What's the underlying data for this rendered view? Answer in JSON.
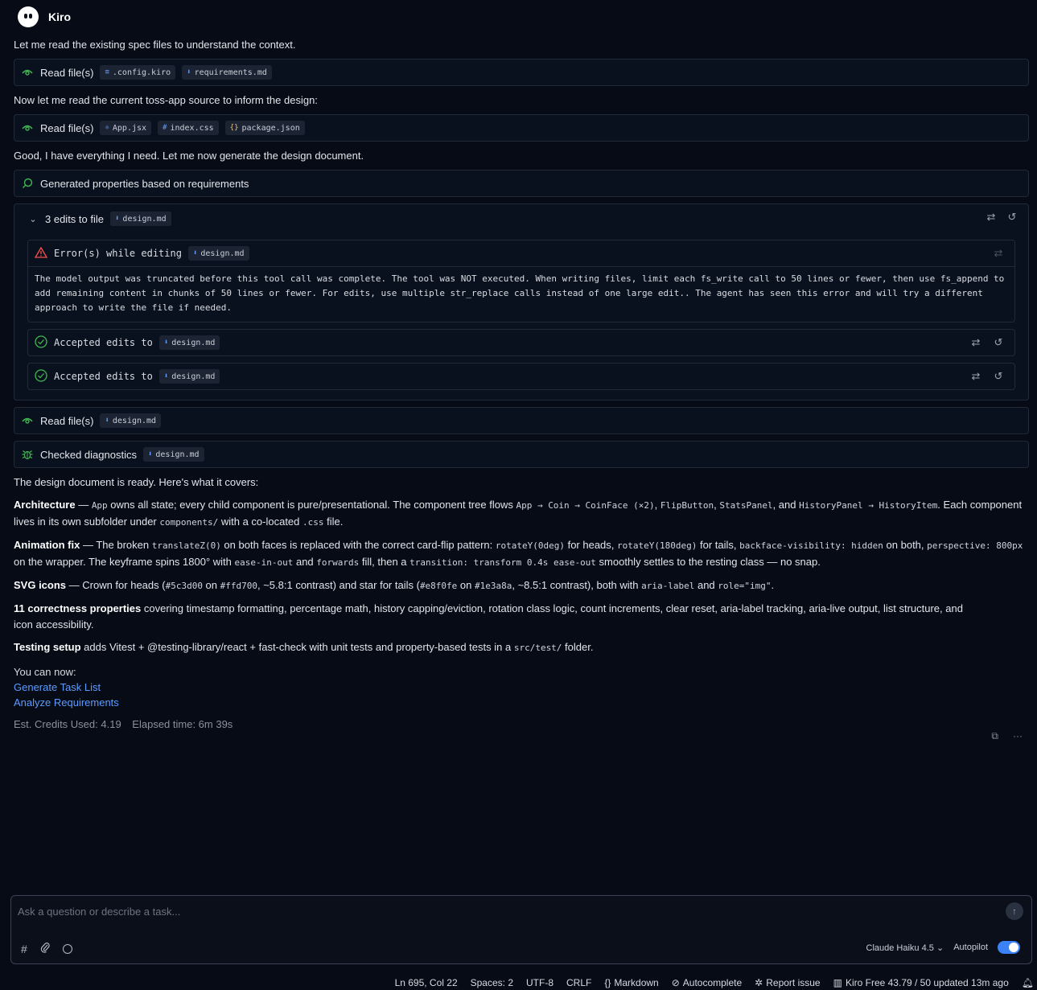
{
  "header": {
    "name": "Kiro"
  },
  "messages": {
    "m1": "Let me read the existing spec files to understand the context.",
    "m2": "Now let me read the current toss-app source to inform the design:",
    "m3": "Good, I have everything I need. Let me now generate the design document."
  },
  "read1": {
    "label": "Read file(s)",
    "files": [
      ".config.kiro",
      "requirements.md"
    ]
  },
  "read2": {
    "label": "Read file(s)",
    "files": [
      "App.jsx",
      "index.css",
      "package.json"
    ]
  },
  "generated": {
    "label": "Generated properties based on requirements"
  },
  "edits": {
    "label": "3 edits to file",
    "file": "design.md",
    "error": {
      "title": "Error(s) while editing",
      "file": "design.md",
      "body": "The model output was truncated before this tool call was complete. The tool was NOT executed. When writing files, limit each fs_write call to 50 lines or fewer, then use fs_append to add remaining content in chunks of 50 lines or fewer. For edits, use multiple str_replace calls instead of one large edit.. The agent has seen this error and will try a different approach to write the file if needed."
    },
    "accepted": [
      {
        "title": "Accepted edits to",
        "file": "design.md"
      },
      {
        "title": "Accepted edits to",
        "file": "design.md"
      }
    ]
  },
  "read3": {
    "label": "Read file(s)",
    "file": "design.md"
  },
  "diagnostics": {
    "label": "Checked diagnostics",
    "file": "design.md"
  },
  "summary": {
    "intro": "The design document is ready. Here's what it covers:",
    "arch": {
      "title": "Architecture",
      "t1": " — ",
      "c1": "App",
      "t2": " owns all state; every child component is pure/presentational. The component tree flows ",
      "c2": "App → Coin → CoinFace (×2)",
      "t3": ", ",
      "c3": "FlipButton",
      "t4": ", ",
      "c4": "StatsPanel",
      "t5": ", and ",
      "c5": "HistoryPanel → HistoryItem",
      "t6": ". Each component lives in its own subfolder under ",
      "c6": "components/",
      "t7": " with a co-located ",
      "c7": ".css",
      "t8": " file."
    },
    "anim": {
      "title": "Animation fix",
      "t1": " — The broken ",
      "c1": "translateZ(0)",
      "t2": " on both faces is replaced with the correct card-flip pattern: ",
      "c2": "rotateY(0deg)",
      "t3": " for heads, ",
      "c3": "rotateY(180deg)",
      "t4": " for tails, ",
      "c4": "backface-visibility: hidden",
      "t5": " on both, ",
      "c5": "perspective: 800px",
      "t6": " on the wrapper. The keyframe spins 1800° with ",
      "c6": "ease-in-out",
      "t7": " and ",
      "c7": "forwards",
      "t8": " fill, then a ",
      "c8": "transition: transform 0.4s ease-out",
      "t9": " smoothly settles to the resting class — no snap."
    },
    "svg": {
      "title": "SVG icons",
      "t1": " — Crown for heads (",
      "c1": "#5c3d00",
      "t2": " on ",
      "c2": "#ffd700",
      "t3": ", ~5.8:1 contrast) and star for tails (",
      "c3": "#e8f0fe",
      "t4": " on ",
      "c4": "#1e3a8a",
      "t5": ", ~8.5:1 contrast), both with ",
      "c5": "aria-label",
      "t6": " and ",
      "c6": "role=\"img\"",
      "t7": "."
    },
    "props": {
      "title": "11 correctness properties",
      "text": " covering timestamp formatting, percentage math, history capping/eviction, rotation class logic, count increments, clear reset, aria-label tracking, aria-live output, list structure, and icon accessibility."
    },
    "testing": {
      "title": "Testing setup",
      "t1": " adds Vitest + @testing-library/react + fast-check with unit tests and property-based tests in a ",
      "c1": "src/test/",
      "t2": " folder."
    },
    "you_can": "You can now:",
    "links": [
      "Generate Task List",
      "Analyze Requirements"
    ],
    "credits": "Est. Credits Used: 4.19",
    "elapsed": "Elapsed time: 6m 39s"
  },
  "input": {
    "placeholder": "Ask a question or describe a task...",
    "model": "Claude Haiku 4.5",
    "autopilot": "Autopilot"
  },
  "status": {
    "position": "Ln 695, Col 22",
    "spaces": "Spaces: 2",
    "encoding": "UTF-8",
    "eol": "CRLF",
    "language": "Markdown",
    "autocomplete": "Autocomplete",
    "report": "Report issue",
    "plan": "Kiro Free 43.79 / 50 updated 13m ago"
  }
}
